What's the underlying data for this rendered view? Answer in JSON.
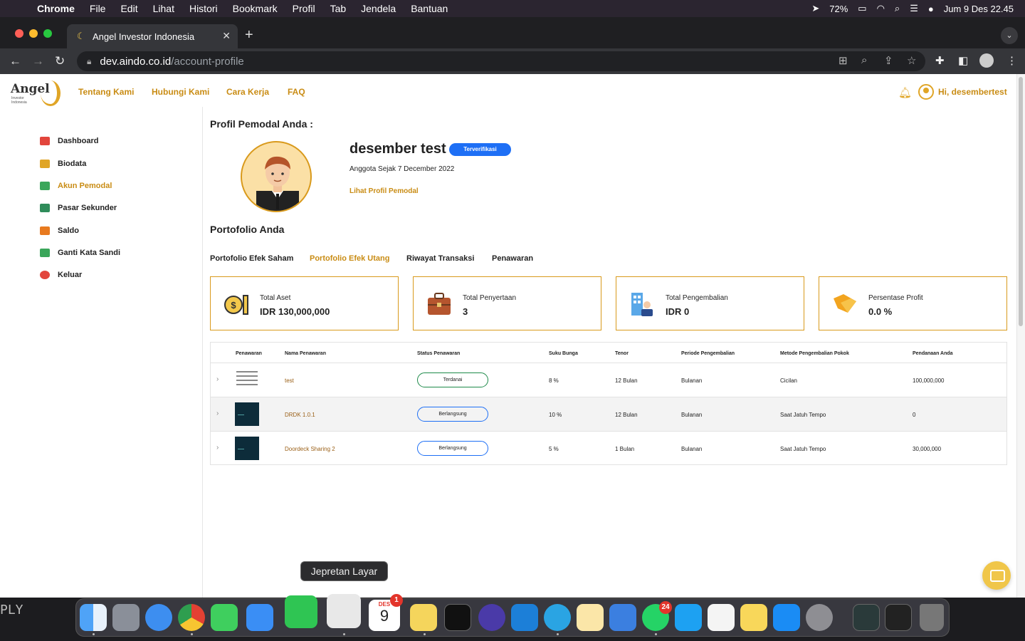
{
  "menubar": {
    "items": [
      "Chrome",
      "File",
      "Edit",
      "Lihat",
      "Histori",
      "Bookmark",
      "Profil",
      "Tab",
      "Jendela",
      "Bantuan"
    ],
    "battery": "72%",
    "datetime": "Jum 9 Des  22.45"
  },
  "browser": {
    "tab_title": "Angel Investor Indonesia",
    "url_domain": "dev.aindo.co.id",
    "url_path": "/account-profile"
  },
  "site": {
    "logo_word": "Angel",
    "logo_sub": "Investor\nIndonesia",
    "nav": [
      "Tentang Kami",
      "Hubungi Kami",
      "Cara Kerja",
      "FAQ"
    ],
    "greeting": "Hi, desembertest"
  },
  "sidebar": {
    "items": [
      {
        "label": "Dashboard",
        "icon": "home-icon",
        "color": "#e2453c"
      },
      {
        "label": "Biodata",
        "icon": "id-card-icon",
        "color": "#e0a526"
      },
      {
        "label": "Akun Pemodal",
        "icon": "rocket-icon",
        "color": "#3aa65a"
      },
      {
        "label": "Pasar Sekunder",
        "icon": "store-icon",
        "color": "#2f8c5a"
      },
      {
        "label": "Saldo",
        "icon": "wallet-icon",
        "color": "#e87a1f"
      },
      {
        "label": "Ganti Kata Sandi",
        "icon": "lock-icon",
        "color": "#3aa65a"
      },
      {
        "label": "Keluar",
        "icon": "power-icon",
        "color": "#e2453c"
      }
    ],
    "active_index": 2
  },
  "profile": {
    "heading": "Profil Pemodal Anda :",
    "name": "desember test",
    "verified_label": "Terverifikasi",
    "member_since": "Anggota Sejak 7 December 2022",
    "view_profile_link": "Lihat Profil Pemodal"
  },
  "portfolio": {
    "heading": "Portofolio Anda",
    "tabs": [
      "Portofolio Efek Saham",
      "Portofolio Efek Utang",
      "Riwayat Transaksi",
      "Penawaran"
    ],
    "active_tab": 1,
    "cards": [
      {
        "label": "Total Aset",
        "value": "IDR 130,000,000",
        "icon": "coin-icon"
      },
      {
        "label": "Total Penyertaan",
        "value": "3",
        "icon": "briefcase-icon"
      },
      {
        "label": "Total Pengembalian",
        "value": "IDR 0",
        "icon": "investor-building-icon"
      },
      {
        "label": "Persentase Profit",
        "value": "0.0 %",
        "icon": "handshake-icon"
      }
    ]
  },
  "table": {
    "headers": [
      "Penawaran",
      "Nama Penawaran",
      "Status Penawaran",
      "Suku Bunga",
      "Tenor",
      "Periode Pengembalian",
      "Metode Pengembalian Pokok",
      "Pendanaan Anda"
    ],
    "rows": [
      {
        "name": "test",
        "status": "Terdanai",
        "rate": "8 %",
        "tenor": "12 Bulan",
        "period": "Bulanan",
        "method": "Cicilan",
        "funding": "100,000,000"
      },
      {
        "name": "DRDK 1.0.1",
        "status": "Berlangsung",
        "rate": "10 %",
        "tenor": "12 Bulan",
        "period": "Bulanan",
        "method": "Saat Jatuh Tempo",
        "funding": "0"
      },
      {
        "name": "Doordeck Sharing 2",
        "status": "Berlangsung",
        "rate": "5 %",
        "tenor": "1 Bulan",
        "period": "Bulanan",
        "method": "Saat Jatuh Tempo",
        "funding": "30,000,000"
      }
    ]
  },
  "desktop": {
    "side_text": "PLY",
    "tooltip": "Jepretan Layar",
    "calendar_month": "DES",
    "calendar_day": "9",
    "calendar_badge": "1",
    "whatsapp_badge": "24"
  }
}
